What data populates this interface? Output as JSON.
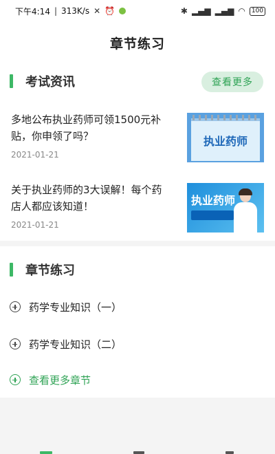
{
  "status_bar": {
    "time": "下午4:14",
    "speed": "313K/s",
    "battery": "100"
  },
  "header": {
    "title": "章节练习"
  },
  "news_section": {
    "title": "考试资讯",
    "more_label": "查看更多",
    "items": [
      {
        "title": "多地公布执业药师可领1500元补贴，你申领了吗？",
        "date": "2021-01-21",
        "thumb_text": "执业药师"
      },
      {
        "title": "关于执业药师的3大误解！每个药店人都应该知道！",
        "date": "2021-01-21",
        "thumb_text": "执业药师"
      }
    ]
  },
  "chapter_section": {
    "title": "章节练习",
    "items": [
      {
        "label": "药学专业知识（一）"
      },
      {
        "label": "药学专业知识（二）"
      }
    ],
    "more_label": "查看更多章节"
  },
  "colors": {
    "accent": "#3db866",
    "accent_text": "#2fa355",
    "pill_bg": "#d9efe0"
  },
  "icons": [
    "bluetooth-icon",
    "signal-icon",
    "wifi-icon",
    "alarm-icon",
    "battery-icon",
    "plus-circle-icon"
  ]
}
